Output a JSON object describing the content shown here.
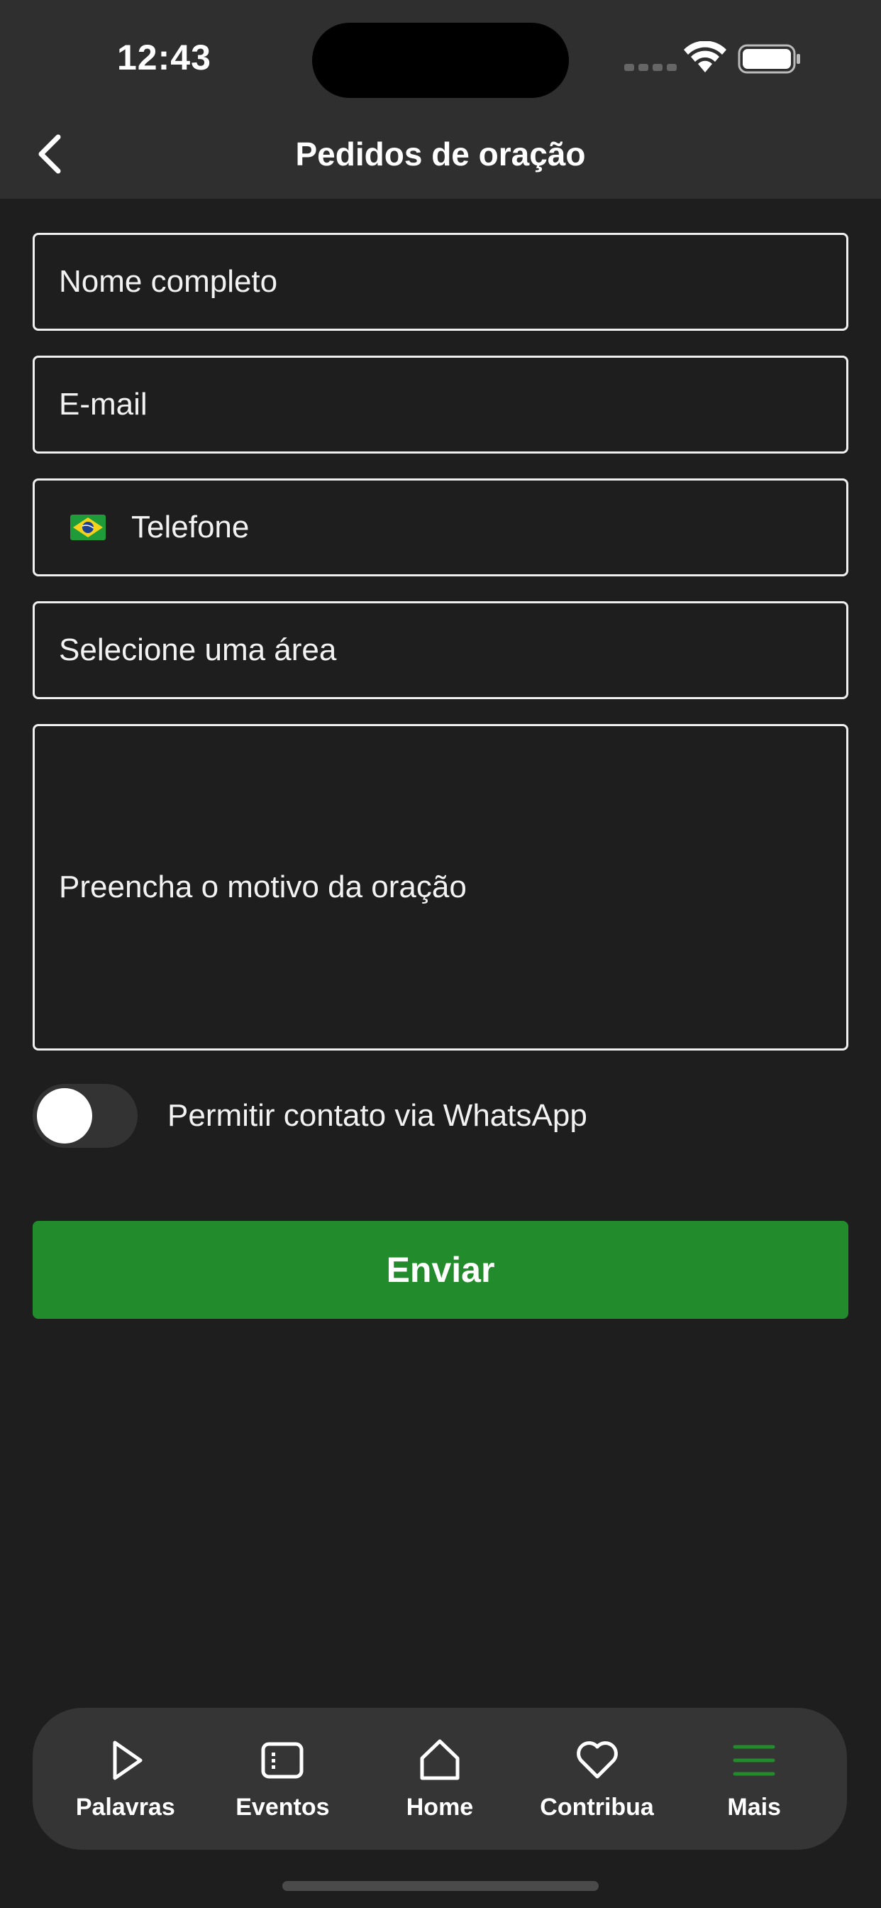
{
  "status_bar": {
    "time": "12:43"
  },
  "header": {
    "title": "Pedidos de oração"
  },
  "form": {
    "name_placeholder": "Nome completo",
    "email_placeholder": "E-mail",
    "phone_placeholder": "Telefone",
    "area_placeholder": "Selecione uma área",
    "reason_placeholder": "Preencha o motivo da oração",
    "whatsapp_label": "Permitir contato via WhatsApp",
    "whatsapp_enabled": false,
    "submit_label": "Enviar"
  },
  "tabbar": {
    "items": [
      {
        "label": "Palavras",
        "icon": "play-icon"
      },
      {
        "label": "Eventos",
        "icon": "calendar-icon"
      },
      {
        "label": "Home",
        "icon": "home-icon"
      },
      {
        "label": "Contribua",
        "icon": "heart-icon"
      },
      {
        "label": "Mais",
        "icon": "menu-icon",
        "active": true
      }
    ]
  },
  "colors": {
    "background": "#1e1e1e",
    "header": "#2f2f2f",
    "accent_green": "#228b2c",
    "tabbar": "#353535"
  }
}
